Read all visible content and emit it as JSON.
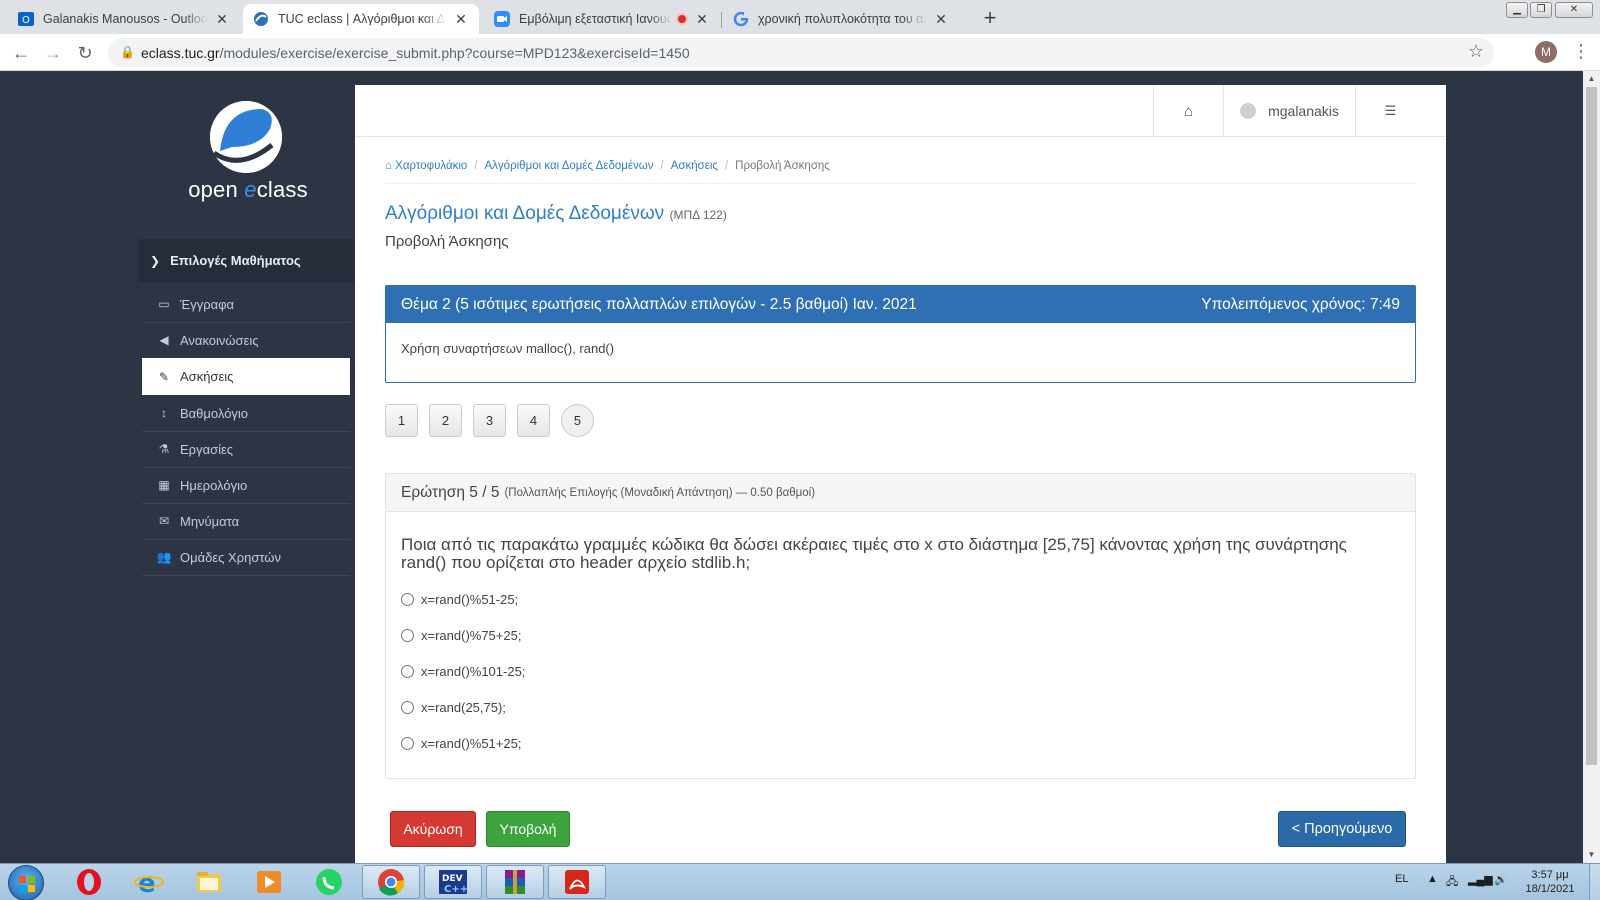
{
  "browser": {
    "tabs": [
      {
        "title": "Galanakis Manousos - Outlook Web",
        "close": "✕"
      },
      {
        "title": "TUC eclass | Αλγόριθμοι και Δομές",
        "close": "✕"
      },
      {
        "title": "Εμβόλιμη εξεταστική Ιανουαρίου",
        "close": ""
      },
      {
        "title": "χρονική πολυπλοκότητα του αλγόριθμου",
        "close": "✕"
      }
    ],
    "new_tab": "+",
    "url_domain": "eclass.tuc.gr",
    "url_path": "/modules/exercise/exercise_submit.php?course=MPD123&exerciseId=1450",
    "profile_initial": "M"
  },
  "sidebar": {
    "logo_word1": "open ",
    "logo_word2": "e",
    "logo_word3": "class",
    "header": "Επιλογές Μαθήματος",
    "items": [
      {
        "label": "Έγγραφα",
        "icon": "folder-icon",
        "glyph": "▭"
      },
      {
        "label": "Ανακοινώσεις",
        "icon": "megaphone-icon",
        "glyph": "◀"
      },
      {
        "label": "Ασκήσεις",
        "icon": "edit-icon",
        "glyph": "✎"
      },
      {
        "label": "Βαθμολόγιο",
        "icon": "sort-icon",
        "glyph": "↕"
      },
      {
        "label": "Εργασίες",
        "icon": "flask-icon",
        "glyph": "⚗"
      },
      {
        "label": "Ημερολόγιο",
        "icon": "calendar-icon",
        "glyph": "▦"
      },
      {
        "label": "Μηνύματα",
        "icon": "envelope-icon",
        "glyph": "✉"
      },
      {
        "label": "Ομάδες Χρηστών",
        "icon": "users-icon",
        "glyph": "👥"
      }
    ],
    "active_index": 2
  },
  "topbar": {
    "home_glyph": "⌂",
    "username": "mgalanakis",
    "settings_glyph": "☰"
  },
  "breadcrumb": {
    "items": [
      "Χαρτοφυλάκιο",
      "Αλγόριθμοι και Δομές Δεδομένων",
      "Ασκήσεις"
    ],
    "current": "Προβολή Άσκησης",
    "separator": "/"
  },
  "course": {
    "title": "Αλγόριθμοι και Δομές Δεδομένων",
    "code": "(ΜΠΔ 122)",
    "subtitle": "Προβολή Άσκησης"
  },
  "exercise": {
    "title": "Θέμα 2 (5 ισότιμες ερωτήσεις πολλαπλών επιλογών - 2.5 βαθμοί) Ιαν. 2021",
    "timer": "Υπολειπόμενος χρόνος: 7:49",
    "description": "Χρήση συναρτήσεων malloc(), rand()"
  },
  "question_nav": {
    "numbers": [
      "1",
      "2",
      "3",
      "4",
      "5"
    ],
    "current": "5"
  },
  "question": {
    "heading": "Ερώτηση 5 / 5",
    "meta": "(Πολλαπλής Επιλογής (Μοναδική Απάντηση) — 0.50 βαθμοί)",
    "text": "Ποια από τις παρακάτω γραμμές κώδικα θα δώσει ακέραιες τιμές στο x στο διάστημα [25,75] κάνοντας χρήση της συνάρτησης rand() που ορίζεται στο header αρχείο stdlib.h;",
    "options": [
      "x=rand()%51-25;",
      "x=rand()%75+25;",
      "x=rand()%101-25;",
      "x=rand(25,75);",
      "x=rand()%51+25;"
    ]
  },
  "buttons": {
    "cancel": "Ακύρωση",
    "submit": "Υποβολή",
    "previous": "< Προηγούμενο"
  },
  "taskbar": {
    "lang": "EL",
    "time": "3:57 μμ",
    "date": "18/1/2021",
    "apps": [
      "opera-icon",
      "ie-icon",
      "explorer-icon",
      "media-icon",
      "whatsapp-icon",
      "chrome-icon",
      "devcpp-icon",
      "winrar-icon",
      "acrobat-icon"
    ]
  },
  "colors": {
    "sidebar_bg": "#2d3544",
    "link": "#2e7fc7",
    "panel_header": "#2e70b3",
    "cancel": "#d43a33",
    "submit": "#3da33d",
    "previous": "#2a6aa8"
  }
}
